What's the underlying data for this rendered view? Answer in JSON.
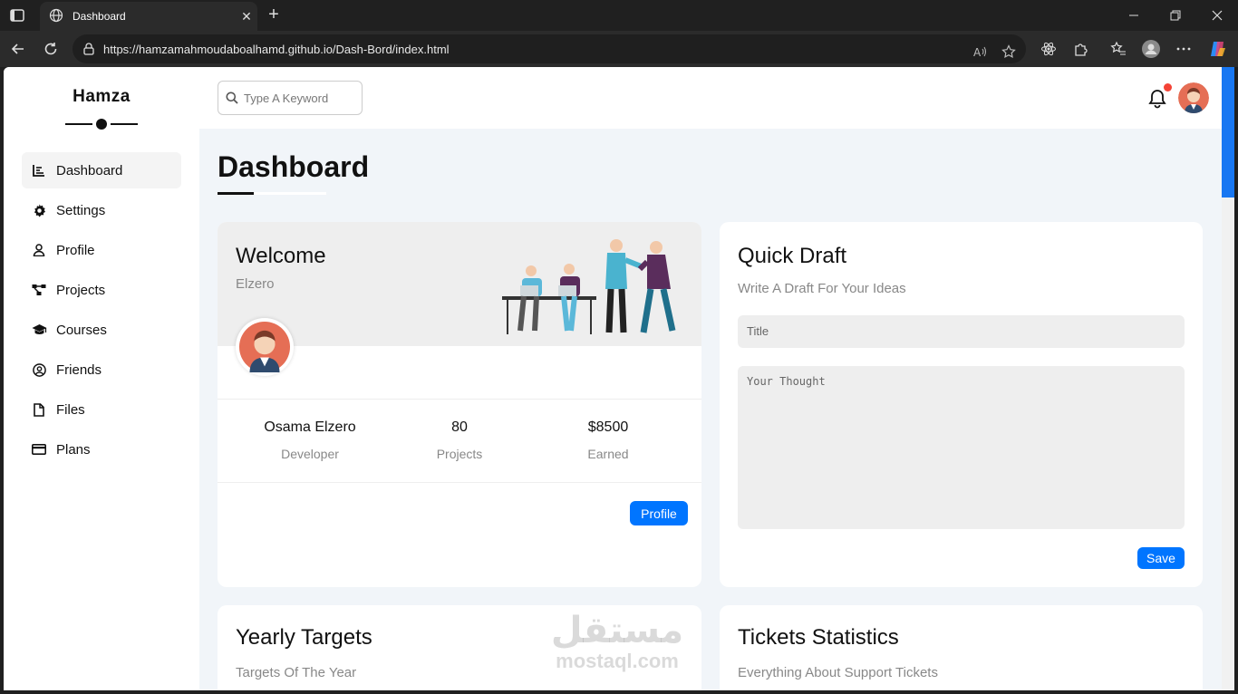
{
  "browser": {
    "tab_title": "Dashboard",
    "url": "https://hamzamahmoudaboalhamd.github.io/Dash-Bord/index.html",
    "min_icon": "minimize-icon",
    "max_icon": "maximize-icon",
    "close_icon": "close-icon"
  },
  "sidebar": {
    "brand": "Hamza",
    "items": [
      {
        "label": "Dashboard",
        "icon": "chart-icon",
        "active": true
      },
      {
        "label": "Settings",
        "icon": "gear-icon"
      },
      {
        "label": "Profile",
        "icon": "user-icon"
      },
      {
        "label": "Projects",
        "icon": "diagram-icon"
      },
      {
        "label": "Courses",
        "icon": "graduation-cap-icon"
      },
      {
        "label": "Friends",
        "icon": "user-circle-icon"
      },
      {
        "label": "Files",
        "icon": "file-icon"
      },
      {
        "label": "Plans",
        "icon": "credit-card-icon"
      }
    ]
  },
  "header": {
    "search_placeholder": "Type A Keyword"
  },
  "main": {
    "title": "Dashboard",
    "welcome": {
      "title": "Welcome",
      "subtitle": "Elzero",
      "name": "Osama Elzero",
      "role": "Developer",
      "projects_value": "80",
      "projects_label": "Projects",
      "earned_value": "$8500",
      "earned_label": "Earned",
      "button": "Profile"
    },
    "quick_draft": {
      "title": "Quick Draft",
      "subtitle": "Write A Draft For Your Ideas",
      "title_placeholder": "Title",
      "thought_placeholder": "Your Thought",
      "button": "Save"
    },
    "yearly_targets": {
      "title": "Yearly Targets",
      "subtitle": "Targets Of The Year"
    },
    "tickets": {
      "title": "Tickets Statistics",
      "subtitle": "Everything About Support Tickets"
    }
  },
  "watermark": {
    "arabic": "مستقل",
    "latin": "mostaql.com"
  },
  "colors": {
    "accent": "#0075ff",
    "notification": "#f44336",
    "page_bg": "#f1f5f9"
  }
}
